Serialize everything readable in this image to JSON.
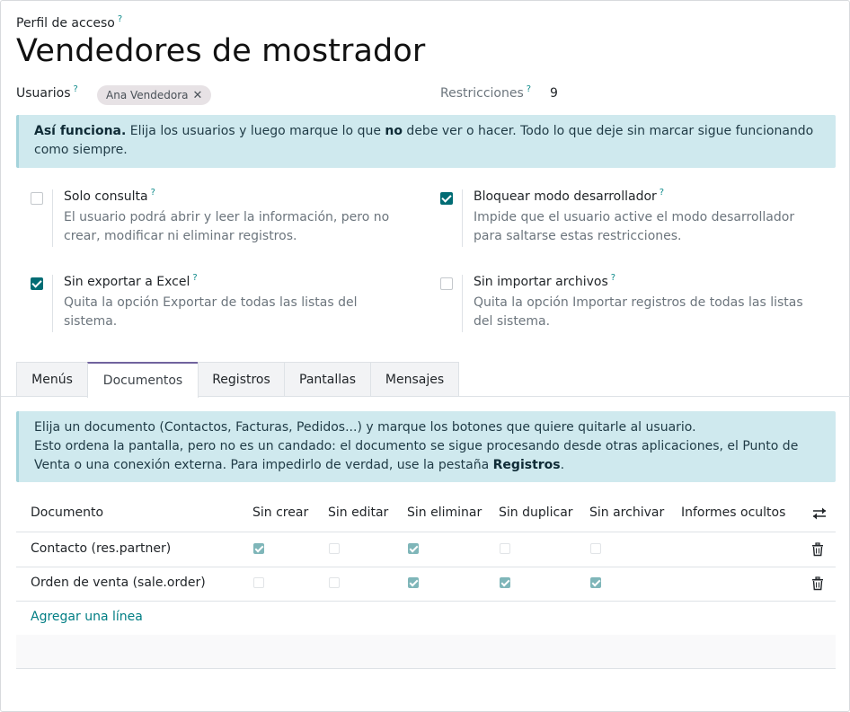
{
  "header": {
    "eyebrow": "Perfil de acceso",
    "help_mark": "?",
    "title": "Vendedores de mostrador"
  },
  "fields": {
    "users_label": "Usuarios",
    "users": [
      {
        "name": "Ana Vendedora",
        "remove": "✕"
      }
    ],
    "restrictions_label": "Restricciones",
    "restrictions_value": "9"
  },
  "intro_alert": {
    "lead": "Así funciona.",
    "part1": " Elija los usuarios y luego marque lo que ",
    "emph": "no",
    "part2": " debe ver o hacer. Todo lo que deje sin marcar sigue funcionando como siempre."
  },
  "options": [
    {
      "title": "Solo consulta",
      "desc": "El usuario podrá abrir y leer la información, pero no crear, modificar ni eliminar registros.",
      "checked": false
    },
    {
      "title": "Bloquear modo desarrollador",
      "desc": "Impide que el usuario active el modo desarrollador para saltarse estas restricciones.",
      "checked": true
    },
    {
      "title": "Sin exportar a Excel",
      "desc": "Quita la opción Exportar de todas las listas del sistema.",
      "checked": true
    },
    {
      "title": "Sin importar archivos",
      "desc": "Quita la opción Importar registros de todas las listas del sistema.",
      "checked": false
    }
  ],
  "tabs": [
    {
      "label": "Menús",
      "active": false
    },
    {
      "label": "Documentos",
      "active": true
    },
    {
      "label": "Registros",
      "active": false
    },
    {
      "label": "Pantallas",
      "active": false
    },
    {
      "label": "Mensajes",
      "active": false
    }
  ],
  "doc_alert": {
    "line1": "Elija un documento (Contactos, Facturas, Pedidos...) y marque los botones que quiere quitarle al usuario.",
    "line2": "Esto ordena la pantalla, pero no es un candado: el documento se sigue procesando desde otras aplicaciones, el Punto de Venta o una conexión externa. Para impedirlo de verdad, use la pestaña ",
    "link": "Registros",
    "end": "."
  },
  "table": {
    "columns": [
      "Documento",
      "Sin crear",
      "Sin editar",
      "Sin eliminar",
      "Sin duplicar",
      "Sin archivar",
      "Informes ocultos"
    ],
    "rows": [
      {
        "document": "Contacto (res.partner)",
        "flags": [
          true,
          false,
          true,
          false,
          false
        ],
        "reports": ""
      },
      {
        "document": "Orden de venta (sale.order)",
        "flags": [
          false,
          false,
          true,
          true,
          true
        ],
        "reports": ""
      }
    ],
    "add_line": "Agregar una línea"
  },
  "colors": {
    "accent": "#017e84",
    "tab_active": "#71639e",
    "alert_bg": "#cfe9ee",
    "tag_bg": "#e7e2e5"
  }
}
